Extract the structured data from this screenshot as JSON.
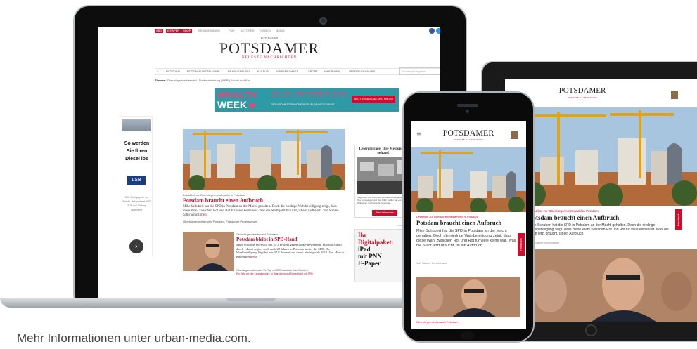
{
  "site": {
    "brand": "POTSDAMER",
    "brand_top": "POTSDAMER",
    "brand_subtitle": "NEUESTE NACHRICHTEN",
    "brand_color": "#c8102e"
  },
  "laptop": {
    "topbar": {
      "tabs": [
        "ABO",
        "E-PAPER",
        "SHOP"
      ],
      "links": [
        "BRANDENBURG",
        "PNN",
        "AUTOREN",
        "THEMEN",
        "MEDIA"
      ],
      "social_icons": [
        "facebook-icon",
        "twitter-icon",
        "instagram-icon",
        "youtube-icon"
      ]
    },
    "nav": {
      "items": [
        "POTSDAM",
        "POTSDAM-MITTELMARK",
        "BRANDENBURG",
        "KULTUR",
        "WISSENSCHAFT",
        "SPORT",
        "IMMOBILIEN",
        "ÜBERREGIONALES"
      ],
      "search_placeholder": "Suchbegriff eingeben"
    },
    "themen": {
      "label": "Themen:",
      "items": "Oberbürgermeisterwahl  |  Stadtentwicklung  |  BER  |  Schule und Kita"
    },
    "banner": {
      "line1": "HEALTH",
      "line2": "WEEK",
      "date": "15.-20. OKTOBER 2019",
      "subtitle": "GESUNDHEITSWOCHE BERLIN-BRANDENBURG",
      "cta": "JETZT VERANSTALTUNG FINDEN"
    },
    "side_ad": {
      "headline": "So werden Sie Ihren Diesel los",
      "logo": "LSB",
      "small_text": "80% Erfolgsquote vor Gericht. Bekannt aus ARD, ZDF und Stiftung Warentest."
    },
    "main_article": {
      "kicker": "Leitartikel zur Oberbürgermeisterwahl in Potsdam",
      "headline": "Potsdam braucht einen Aufbruch",
      "teaser": "Mike Schubert hat die SPD in Potsdam an der Macht gehalten. Doch die niedrige Wahlbeteiligung zeigt, dass diese Wahl zwischen Rot und Rot für viele keine war. Was die Stadt jetzt braucht, ist ein Aufbruch.",
      "author": "Von Sabine Schicketanz",
      "more": "mehr",
      "related": "Oberbürgermeisterwahl Potsdam: Potsdamer Protestzonen"
    },
    "second_article": {
      "kicker": "Oberbürgermeisterwahl Potsdam",
      "headline": "Potsdam bleibt in SPD-Hand",
      "teaser": "Mike Schubert setzt sich mit 55,3 Prozent gegen Linke-Bewerberin Martina Trauth durch - damit regiert auch nach 28 Jahren in Potsdam weiter die SPD. Die Wahlbeteiligung liegt bei nur 37,8 Prozent und damit niedriger als 2010.",
      "author": "Von Marion Kaufmann",
      "more": "mehr",
      "related1": "Oberbürgermeisterwahl: Ein Tag mit SPD-Kandidat Mike Schubert",
      "related2": "Ein Jahr vor der Landtagswahl: In Brandenburg AfD gleichauf mit SPD"
    },
    "poll": {
      "question": "Leserumfrage: Ihre Meinung ist gefragt!",
      "text": "Sagen Sie uns, wie Ihnen der neue Auftritt gefällt. Dann Ihre Anregungen und Ihre Kritik: Helfen Sie uns, Ihren Wünschen noch gerecht zu werden.",
      "button": "Jetzt teilnehmen"
    },
    "epaper_ad": {
      "line1": "Ihr",
      "line2": "Digitalpaket:",
      "line3": "iPad",
      "line4": "mit PNN",
      "line5": "E-Paper",
      "label": "Anzeige"
    }
  },
  "tablet": {
    "article": {
      "kicker": "Leitartikel zur Oberbürgermeisterwahl in Potsdam",
      "headline": "Potsdam braucht einen Aufbruch",
      "teaser": "Mike Schubert hat die SPD in Potsdam an der Macht gehalten. Doch die niedrige Wahlbeteiligung zeigt, dass diese Wahl zwischen Rot und Rot für viele keine war. Was die Stadt jetzt braucht, ist ein Aufbruch.",
      "author": "Von Sabine Schicketanz"
    },
    "feedback": "Feedback"
  },
  "phone": {
    "article": {
      "kicker": "Leitartikel zur Oberbürgermeisterwahl in Potsdam",
      "headline": "Potsdam braucht einen Aufbruch",
      "teaser": "Mike Schubert hat die SPD in Potsdam an der Macht gehalten. Doch die niedrige Wahlbeteiligung zeigt, dass diese Wahl zwischen Rot und Rot für viele keine war. Was die Stadt jetzt braucht, ist ein Aufbruch.",
      "author": "Von Sabine Schicketanz"
    },
    "next_kicker": "Oberbürgermeisterwahl Potsdam",
    "feedback": "Feedback"
  },
  "caption": "Mehr Informationen unter urban-media.com."
}
